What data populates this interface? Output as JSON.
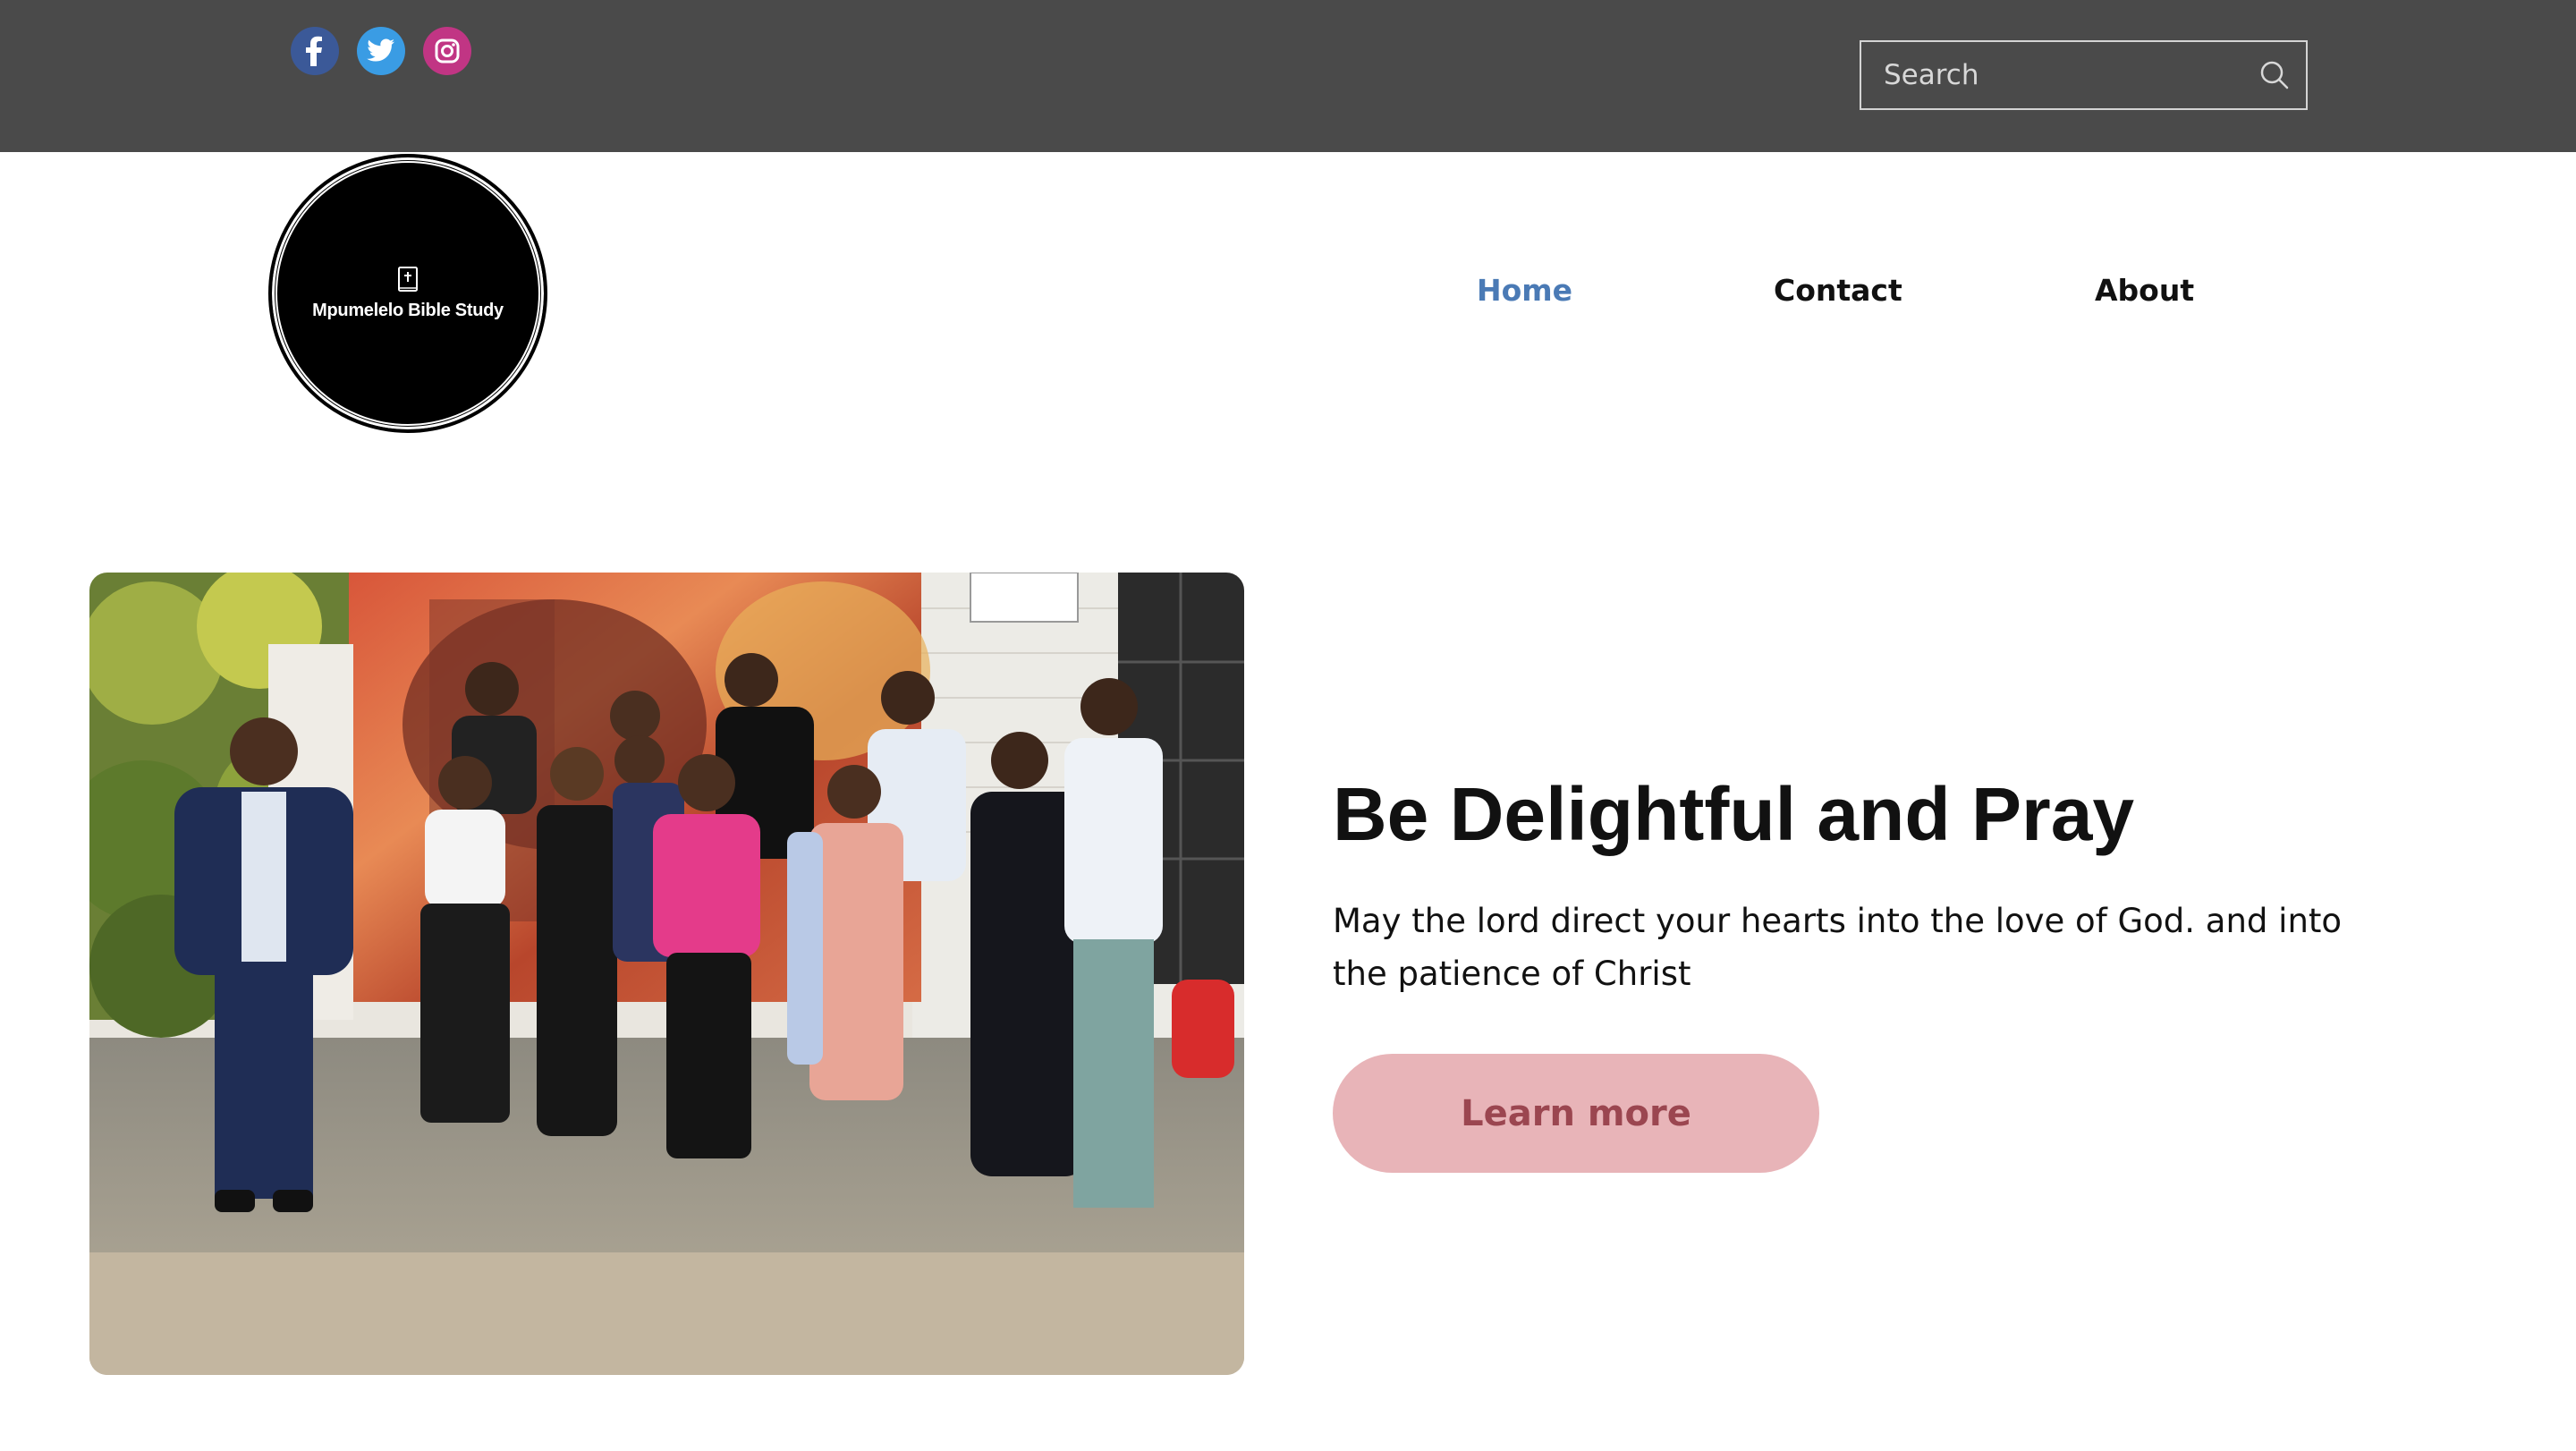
{
  "social": {
    "facebook": "facebook-icon",
    "twitter": "twitter-icon",
    "instagram": "instagram-icon"
  },
  "search": {
    "placeholder": "Search",
    "icon": "search-icon"
  },
  "logo": {
    "text": "Mpumelelo Bible Study",
    "icon": "bible-icon"
  },
  "nav": {
    "items": [
      {
        "label": "Home",
        "active": true
      },
      {
        "label": "Contact",
        "active": false
      },
      {
        "label": "About",
        "active": false
      }
    ]
  },
  "hero": {
    "title": "Be Delightful and Pray",
    "text": "May the lord direct your hearts into the love of God. and into the patience of Christ",
    "button_label": "Learn more"
  },
  "colors": {
    "topbar": "#4a4a4a",
    "nav_active": "#4a7ab5",
    "button_bg": "#e8b4b8",
    "button_text": "#9b4650"
  }
}
